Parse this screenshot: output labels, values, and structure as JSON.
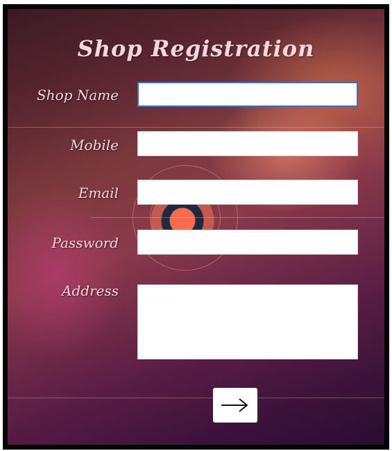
{
  "form": {
    "title": "Shop Registration",
    "fields": {
      "shop_name": {
        "label": "Shop Name",
        "value": ""
      },
      "mobile": {
        "label": "Mobile",
        "value": ""
      },
      "email": {
        "label": "Email",
        "value": ""
      },
      "password": {
        "label": "Password",
        "value": ""
      },
      "address": {
        "label": "Address",
        "value": ""
      }
    },
    "submit": {
      "icon": "arrow-right-icon"
    }
  },
  "colors": {
    "label_text": "#f3d5dc",
    "field_background": "#ffffff",
    "focus_border": "#3a72c8",
    "frame_border": "#050505"
  }
}
